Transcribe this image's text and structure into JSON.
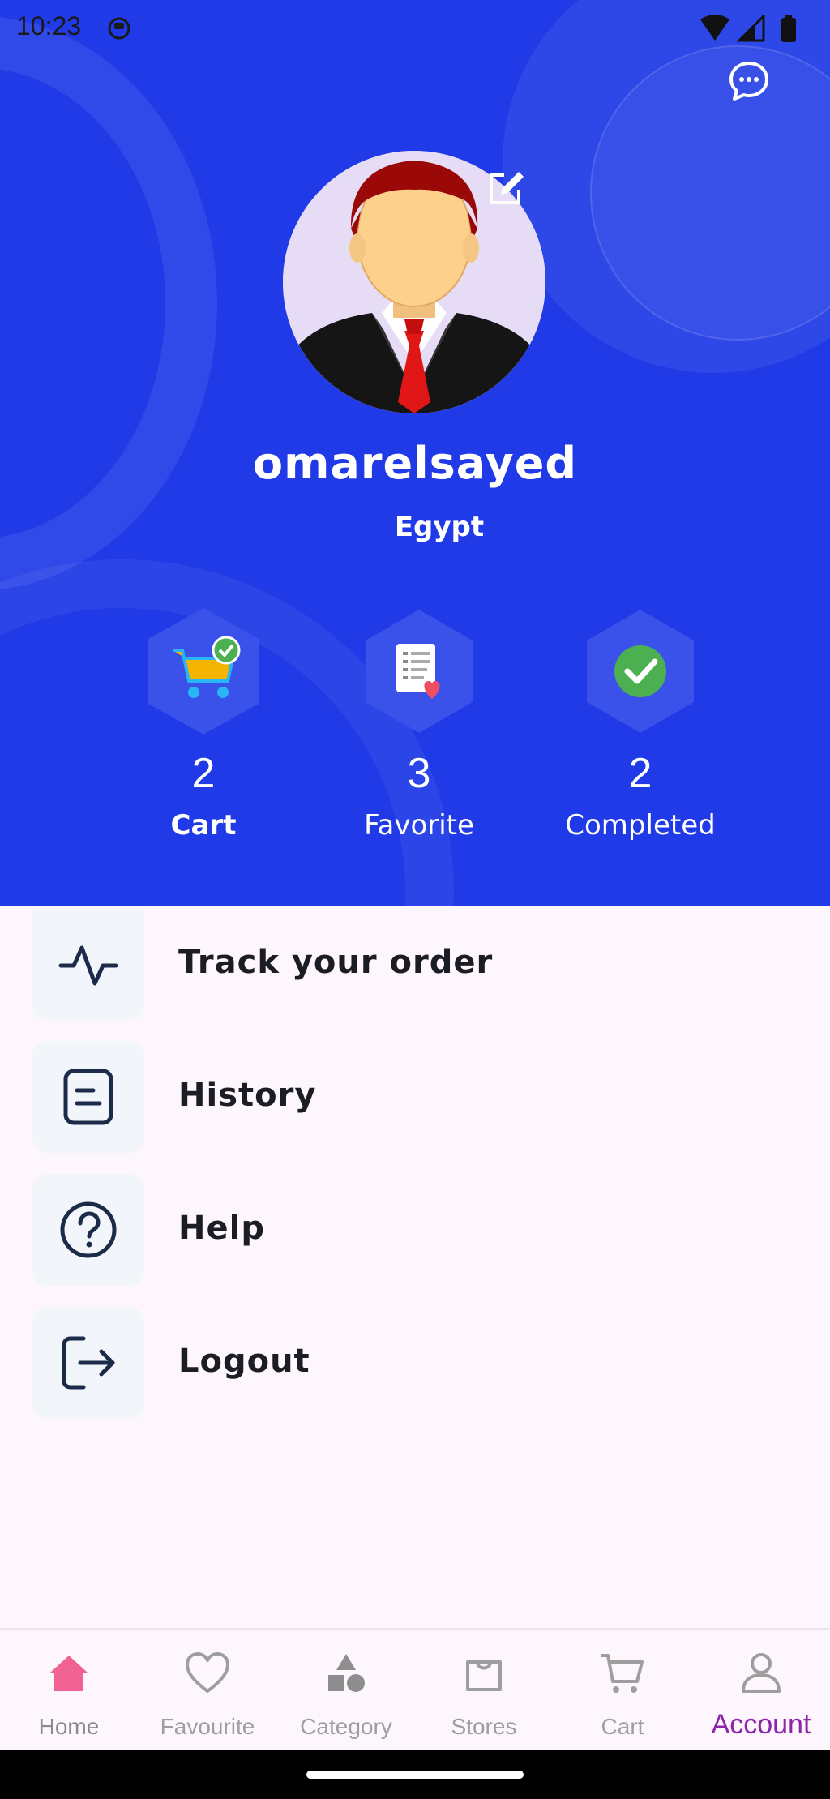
{
  "status_bar": {
    "time": "10:23"
  },
  "profile": {
    "username": "omarelsayed",
    "country": "Egypt"
  },
  "stats": [
    {
      "value": "2",
      "label": "Cart"
    },
    {
      "value": "3",
      "label": "Favorite"
    },
    {
      "value": "2",
      "label": "Completed"
    }
  ],
  "menu": [
    {
      "label": "Track your order",
      "icon": "activity-icon"
    },
    {
      "label": "History",
      "icon": "document-icon"
    },
    {
      "label": "Help",
      "icon": "help-circle-icon"
    },
    {
      "label": "Logout",
      "icon": "logout-icon"
    }
  ],
  "bottom_nav": [
    {
      "label": "Home",
      "icon": "home-icon"
    },
    {
      "label": "Favourite",
      "icon": "heart-icon"
    },
    {
      "label": "Category",
      "icon": "category-icon"
    },
    {
      "label": "Stores",
      "icon": "bag-icon"
    },
    {
      "label": "Cart",
      "icon": "cart-icon"
    },
    {
      "label": "Account",
      "icon": "person-icon",
      "selected": true
    }
  ],
  "colors": {
    "header_bg": "#1f3ae6",
    "page_bg": "#fdf7fd",
    "active_nav": "#8e24aa",
    "home_icon": "#f06292",
    "hex_badge": "#3a52ea"
  }
}
